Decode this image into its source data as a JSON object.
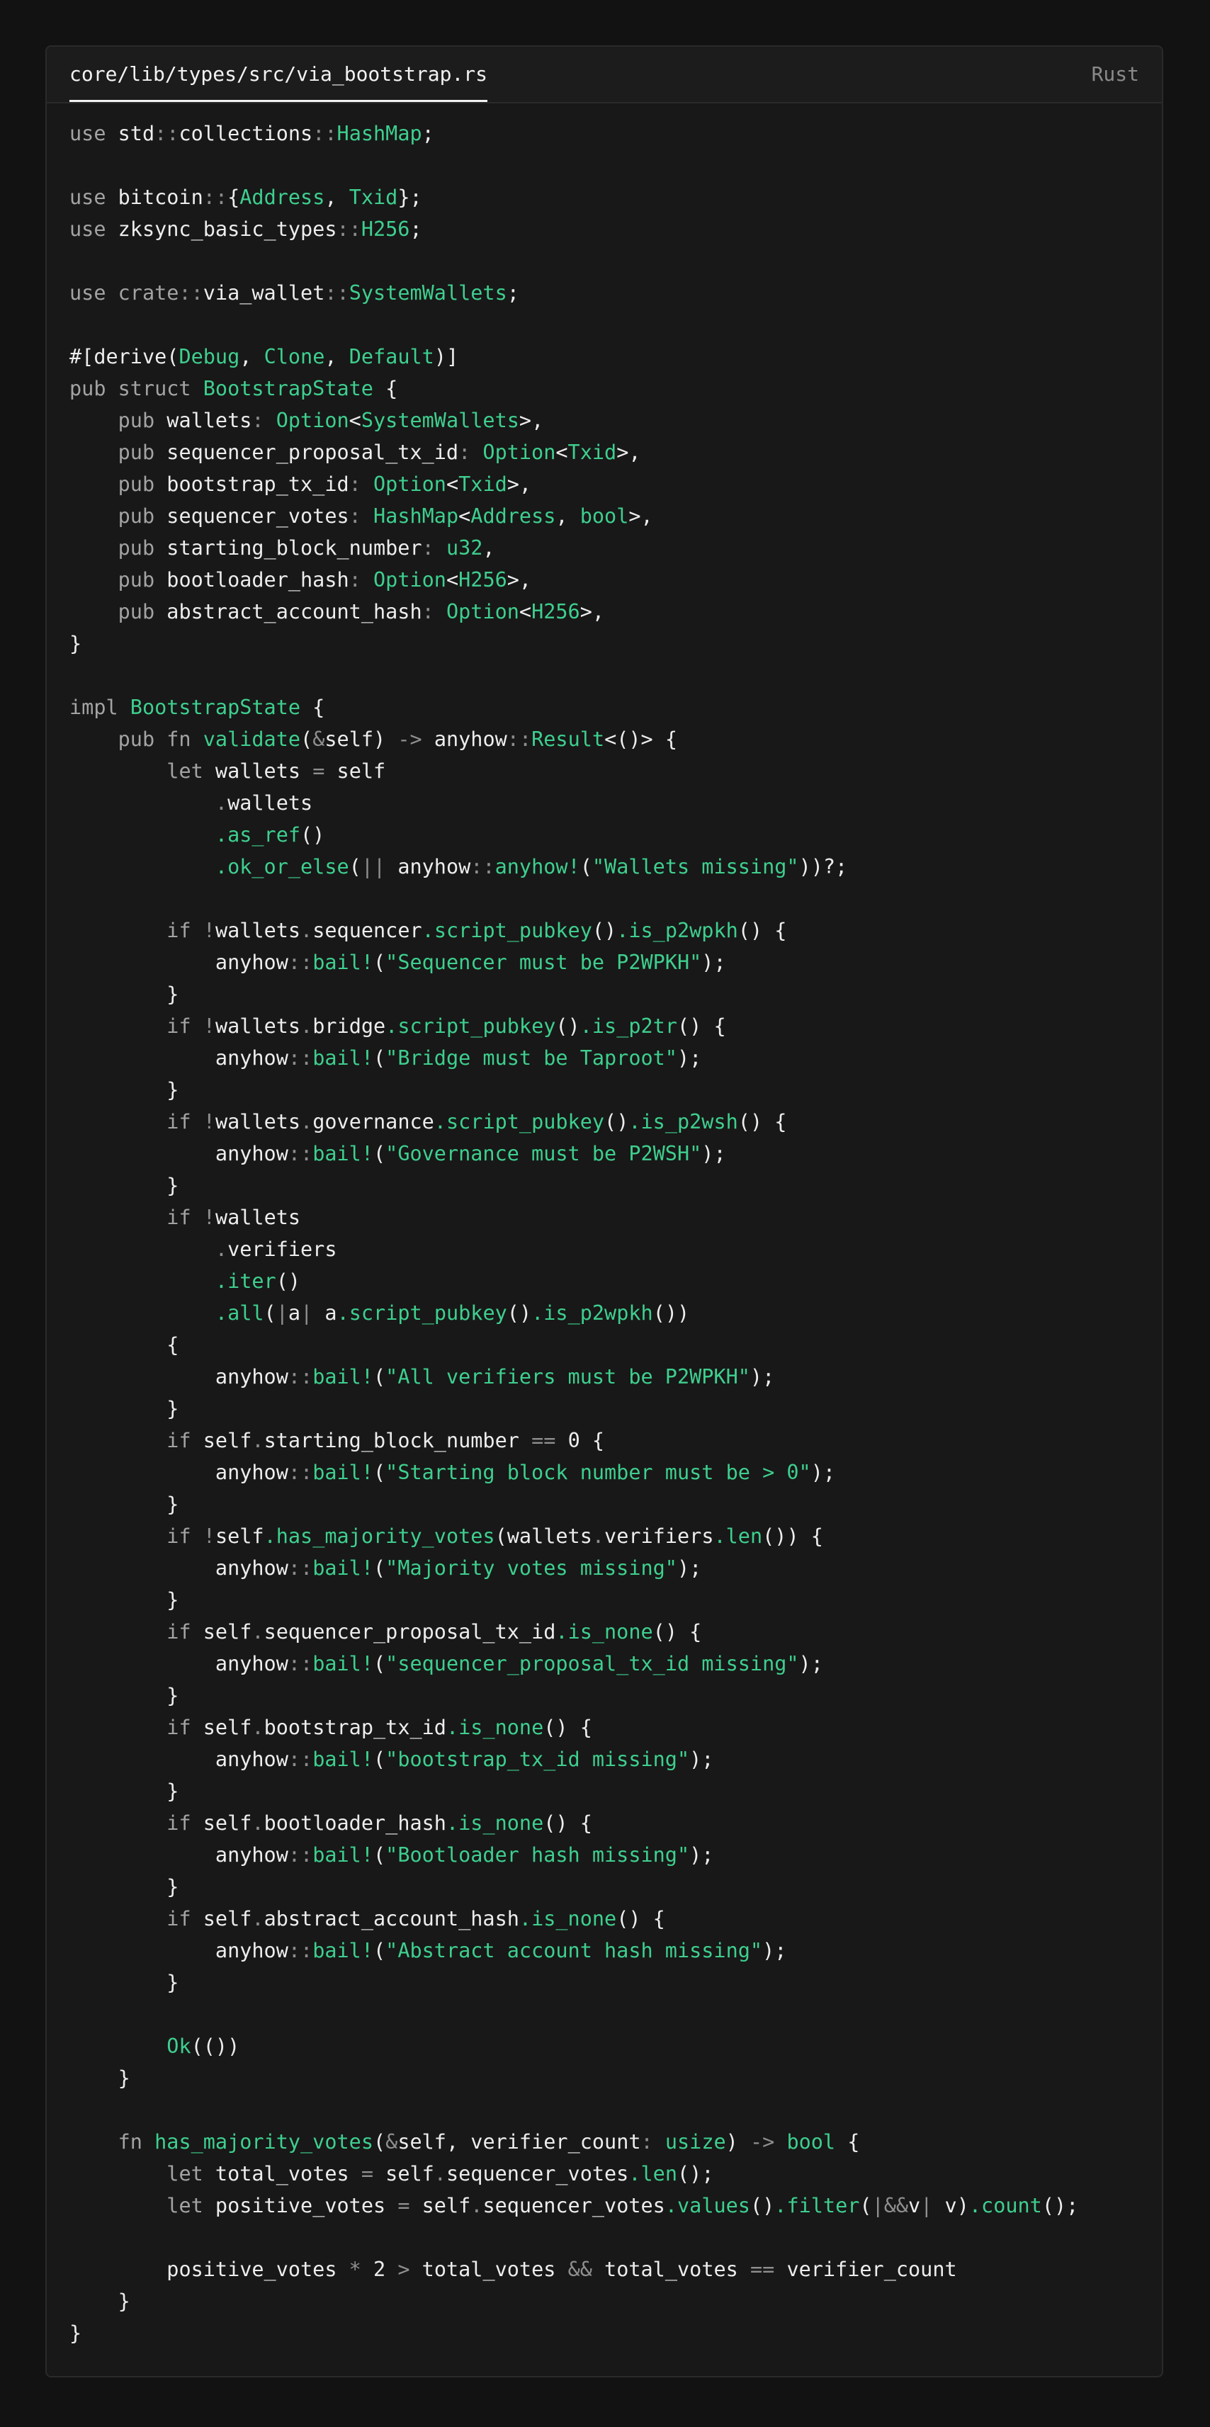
{
  "file": {
    "path": "core/lib/types/src/via_bootstrap.rs",
    "language": "Rust"
  },
  "theme": {
    "background": "#121212",
    "panel": "#181818",
    "keyword": "#a3a3a3",
    "identifier": "#ededed",
    "accent": "#3ecf8e",
    "operator": "#8f8f8f"
  },
  "code_lines": [
    [
      [
        "kw",
        "use "
      ],
      [
        "id",
        "std"
      ],
      [
        "op",
        "::"
      ],
      [
        "id",
        "collections"
      ],
      [
        "op",
        "::"
      ],
      [
        "ty",
        "HashMap"
      ],
      [
        "p",
        ";"
      ]
    ],
    [],
    [
      [
        "kw",
        "use "
      ],
      [
        "id",
        "bitcoin"
      ],
      [
        "op",
        "::"
      ],
      [
        "p",
        "{"
      ],
      [
        "ty",
        "Address"
      ],
      [
        "p",
        ", "
      ],
      [
        "ty",
        "Txid"
      ],
      [
        "p",
        "};"
      ]
    ],
    [
      [
        "kw",
        "use "
      ],
      [
        "id",
        "zksync_basic_types"
      ],
      [
        "op",
        "::"
      ],
      [
        "ty",
        "H256"
      ],
      [
        "p",
        ";"
      ]
    ],
    [],
    [
      [
        "kw",
        "use "
      ],
      [
        "kw",
        "crate"
      ],
      [
        "op",
        "::"
      ],
      [
        "id",
        "via_wallet"
      ],
      [
        "op",
        "::"
      ],
      [
        "ty",
        "SystemWallets"
      ],
      [
        "p",
        ";"
      ]
    ],
    [],
    [
      [
        "p",
        "#["
      ],
      [
        "id",
        "derive"
      ],
      [
        "p",
        "("
      ],
      [
        "ty",
        "Debug"
      ],
      [
        "p",
        ", "
      ],
      [
        "ty",
        "Clone"
      ],
      [
        "p",
        ", "
      ],
      [
        "ty",
        "Default"
      ],
      [
        "p",
        ")]"
      ]
    ],
    [
      [
        "kw",
        "pub struct "
      ],
      [
        "ty",
        "BootstrapState"
      ],
      [
        "p",
        " {"
      ]
    ],
    [
      [
        "p",
        "    "
      ],
      [
        "kw",
        "pub "
      ],
      [
        "id",
        "wallets"
      ],
      [
        "op",
        ": "
      ],
      [
        "ty",
        "Option"
      ],
      [
        "p",
        "<"
      ],
      [
        "ty",
        "SystemWallets"
      ],
      [
        "p",
        ">,"
      ]
    ],
    [
      [
        "p",
        "    "
      ],
      [
        "kw",
        "pub "
      ],
      [
        "id",
        "sequencer_proposal_tx_id"
      ],
      [
        "op",
        ": "
      ],
      [
        "ty",
        "Option"
      ],
      [
        "p",
        "<"
      ],
      [
        "ty",
        "Txid"
      ],
      [
        "p",
        ">,"
      ]
    ],
    [
      [
        "p",
        "    "
      ],
      [
        "kw",
        "pub "
      ],
      [
        "id",
        "bootstrap_tx_id"
      ],
      [
        "op",
        ": "
      ],
      [
        "ty",
        "Option"
      ],
      [
        "p",
        "<"
      ],
      [
        "ty",
        "Txid"
      ],
      [
        "p",
        ">,"
      ]
    ],
    [
      [
        "p",
        "    "
      ],
      [
        "kw",
        "pub "
      ],
      [
        "id",
        "sequencer_votes"
      ],
      [
        "op",
        ": "
      ],
      [
        "ty",
        "HashMap"
      ],
      [
        "p",
        "<"
      ],
      [
        "ty",
        "Address"
      ],
      [
        "p",
        ", "
      ],
      [
        "ty",
        "bool"
      ],
      [
        "p",
        ">,"
      ]
    ],
    [
      [
        "p",
        "    "
      ],
      [
        "kw",
        "pub "
      ],
      [
        "id",
        "starting_block_number"
      ],
      [
        "op",
        ": "
      ],
      [
        "ty",
        "u32"
      ],
      [
        "p",
        ","
      ]
    ],
    [
      [
        "p",
        "    "
      ],
      [
        "kw",
        "pub "
      ],
      [
        "id",
        "bootloader_hash"
      ],
      [
        "op",
        ": "
      ],
      [
        "ty",
        "Option"
      ],
      [
        "p",
        "<"
      ],
      [
        "ty",
        "H256"
      ],
      [
        "p",
        ">,"
      ]
    ],
    [
      [
        "p",
        "    "
      ],
      [
        "kw",
        "pub "
      ],
      [
        "id",
        "abstract_account_hash"
      ],
      [
        "op",
        ": "
      ],
      [
        "ty",
        "Option"
      ],
      [
        "p",
        "<"
      ],
      [
        "ty",
        "H256"
      ],
      [
        "p",
        ">,"
      ]
    ],
    [
      [
        "p",
        "}"
      ]
    ],
    [],
    [
      [
        "kw",
        "impl "
      ],
      [
        "ty",
        "BootstrapState"
      ],
      [
        "p",
        " {"
      ]
    ],
    [
      [
        "p",
        "    "
      ],
      [
        "kw",
        "pub fn "
      ],
      [
        "fn",
        "validate"
      ],
      [
        "p",
        "("
      ],
      [
        "op",
        "&"
      ],
      [
        "id",
        "self"
      ],
      [
        "p",
        ") "
      ],
      [
        "op",
        "-> "
      ],
      [
        "id",
        "anyhow"
      ],
      [
        "op",
        "::"
      ],
      [
        "ty",
        "Result"
      ],
      [
        "p",
        "<()> {"
      ]
    ],
    [
      [
        "p",
        "        "
      ],
      [
        "kw",
        "let "
      ],
      [
        "id",
        "wallets "
      ],
      [
        "op",
        "= "
      ],
      [
        "id",
        "self"
      ]
    ],
    [
      [
        "p",
        "            "
      ],
      [
        "op",
        "."
      ],
      [
        "id",
        "wallets"
      ]
    ],
    [
      [
        "p",
        "            "
      ],
      [
        "fn",
        ".as_ref"
      ],
      [
        "p",
        "()"
      ]
    ],
    [
      [
        "p",
        "            "
      ],
      [
        "fn",
        ".ok_or_else"
      ],
      [
        "p",
        "("
      ],
      [
        "op",
        "|| "
      ],
      [
        "id",
        "anyhow"
      ],
      [
        "op",
        "::"
      ],
      [
        "fn",
        "anyhow!"
      ],
      [
        "p",
        "("
      ],
      [
        "st",
        "\"Wallets missing\""
      ],
      [
        "p",
        "))?;"
      ]
    ],
    [],
    [
      [
        "p",
        "        "
      ],
      [
        "kw",
        "if "
      ],
      [
        "op",
        "!"
      ],
      [
        "id",
        "wallets"
      ],
      [
        "op",
        "."
      ],
      [
        "id",
        "sequencer"
      ],
      [
        "fn",
        ".script_pubkey"
      ],
      [
        "p",
        "()"
      ],
      [
        "fn",
        ".is_p2wpkh"
      ],
      [
        "p",
        "() {"
      ]
    ],
    [
      [
        "p",
        "            "
      ],
      [
        "id",
        "anyhow"
      ],
      [
        "op",
        "::"
      ],
      [
        "fn",
        "bail!"
      ],
      [
        "p",
        "("
      ],
      [
        "st",
        "\"Sequencer must be P2WPKH\""
      ],
      [
        "p",
        ");"
      ]
    ],
    [
      [
        "p",
        "        }"
      ]
    ],
    [
      [
        "p",
        "        "
      ],
      [
        "kw",
        "if "
      ],
      [
        "op",
        "!"
      ],
      [
        "id",
        "wallets"
      ],
      [
        "op",
        "."
      ],
      [
        "id",
        "bridge"
      ],
      [
        "fn",
        ".script_pubkey"
      ],
      [
        "p",
        "()"
      ],
      [
        "fn",
        ".is_p2tr"
      ],
      [
        "p",
        "() {"
      ]
    ],
    [
      [
        "p",
        "            "
      ],
      [
        "id",
        "anyhow"
      ],
      [
        "op",
        "::"
      ],
      [
        "fn",
        "bail!"
      ],
      [
        "p",
        "("
      ],
      [
        "st",
        "\"Bridge must be Taproot\""
      ],
      [
        "p",
        ");"
      ]
    ],
    [
      [
        "p",
        "        }"
      ]
    ],
    [
      [
        "p",
        "        "
      ],
      [
        "kw",
        "if "
      ],
      [
        "op",
        "!"
      ],
      [
        "id",
        "wallets"
      ],
      [
        "op",
        "."
      ],
      [
        "id",
        "governance"
      ],
      [
        "fn",
        ".script_pubkey"
      ],
      [
        "p",
        "()"
      ],
      [
        "fn",
        ".is_p2wsh"
      ],
      [
        "p",
        "() {"
      ]
    ],
    [
      [
        "p",
        "            "
      ],
      [
        "id",
        "anyhow"
      ],
      [
        "op",
        "::"
      ],
      [
        "fn",
        "bail!"
      ],
      [
        "p",
        "("
      ],
      [
        "st",
        "\"Governance must be P2WSH\""
      ],
      [
        "p",
        ");"
      ]
    ],
    [
      [
        "p",
        "        }"
      ]
    ],
    [
      [
        "p",
        "        "
      ],
      [
        "kw",
        "if "
      ],
      [
        "op",
        "!"
      ],
      [
        "id",
        "wallets"
      ]
    ],
    [
      [
        "p",
        "            "
      ],
      [
        "op",
        "."
      ],
      [
        "id",
        "verifiers"
      ]
    ],
    [
      [
        "p",
        "            "
      ],
      [
        "fn",
        ".iter"
      ],
      [
        "p",
        "()"
      ]
    ],
    [
      [
        "p",
        "            "
      ],
      [
        "fn",
        ".all"
      ],
      [
        "p",
        "("
      ],
      [
        "op",
        "|"
      ],
      [
        "id",
        "a"
      ],
      [
        "op",
        "| "
      ],
      [
        "id",
        "a"
      ],
      [
        "fn",
        ".script_pubkey"
      ],
      [
        "p",
        "()"
      ],
      [
        "fn",
        ".is_p2wpkh"
      ],
      [
        "p",
        "())"
      ]
    ],
    [
      [
        "p",
        "        {"
      ]
    ],
    [
      [
        "p",
        "            "
      ],
      [
        "id",
        "anyhow"
      ],
      [
        "op",
        "::"
      ],
      [
        "fn",
        "bail!"
      ],
      [
        "p",
        "("
      ],
      [
        "st",
        "\"All verifiers must be P2WPKH\""
      ],
      [
        "p",
        ");"
      ]
    ],
    [
      [
        "p",
        "        }"
      ]
    ],
    [
      [
        "p",
        "        "
      ],
      [
        "kw",
        "if "
      ],
      [
        "id",
        "self"
      ],
      [
        "op",
        "."
      ],
      [
        "id",
        "starting_block_number "
      ],
      [
        "op",
        "== "
      ],
      [
        "id",
        "0"
      ],
      [
        "p",
        " {"
      ]
    ],
    [
      [
        "p",
        "            "
      ],
      [
        "id",
        "anyhow"
      ],
      [
        "op",
        "::"
      ],
      [
        "fn",
        "bail!"
      ],
      [
        "p",
        "("
      ],
      [
        "st",
        "\"Starting block number must be > 0\""
      ],
      [
        "p",
        ");"
      ]
    ],
    [
      [
        "p",
        "        }"
      ]
    ],
    [
      [
        "p",
        "        "
      ],
      [
        "kw",
        "if "
      ],
      [
        "op",
        "!"
      ],
      [
        "id",
        "self"
      ],
      [
        "fn",
        ".has_majority_votes"
      ],
      [
        "p",
        "("
      ],
      [
        "id",
        "wallets"
      ],
      [
        "op",
        "."
      ],
      [
        "id",
        "verifiers"
      ],
      [
        "fn",
        ".len"
      ],
      [
        "p",
        "()) {"
      ]
    ],
    [
      [
        "p",
        "            "
      ],
      [
        "id",
        "anyhow"
      ],
      [
        "op",
        "::"
      ],
      [
        "fn",
        "bail!"
      ],
      [
        "p",
        "("
      ],
      [
        "st",
        "\"Majority votes missing\""
      ],
      [
        "p",
        ");"
      ]
    ],
    [
      [
        "p",
        "        }"
      ]
    ],
    [
      [
        "p",
        "        "
      ],
      [
        "kw",
        "if "
      ],
      [
        "id",
        "self"
      ],
      [
        "op",
        "."
      ],
      [
        "id",
        "sequencer_proposal_tx_id"
      ],
      [
        "fn",
        ".is_none"
      ],
      [
        "p",
        "() {"
      ]
    ],
    [
      [
        "p",
        "            "
      ],
      [
        "id",
        "anyhow"
      ],
      [
        "op",
        "::"
      ],
      [
        "fn",
        "bail!"
      ],
      [
        "p",
        "("
      ],
      [
        "st",
        "\"sequencer_proposal_tx_id missing\""
      ],
      [
        "p",
        ");"
      ]
    ],
    [
      [
        "p",
        "        }"
      ]
    ],
    [
      [
        "p",
        "        "
      ],
      [
        "kw",
        "if "
      ],
      [
        "id",
        "self"
      ],
      [
        "op",
        "."
      ],
      [
        "id",
        "bootstrap_tx_id"
      ],
      [
        "fn",
        ".is_none"
      ],
      [
        "p",
        "() {"
      ]
    ],
    [
      [
        "p",
        "            "
      ],
      [
        "id",
        "anyhow"
      ],
      [
        "op",
        "::"
      ],
      [
        "fn",
        "bail!"
      ],
      [
        "p",
        "("
      ],
      [
        "st",
        "\"bootstrap_tx_id missing\""
      ],
      [
        "p",
        ");"
      ]
    ],
    [
      [
        "p",
        "        }"
      ]
    ],
    [
      [
        "p",
        "        "
      ],
      [
        "kw",
        "if "
      ],
      [
        "id",
        "self"
      ],
      [
        "op",
        "."
      ],
      [
        "id",
        "bootloader_hash"
      ],
      [
        "fn",
        ".is_none"
      ],
      [
        "p",
        "() {"
      ]
    ],
    [
      [
        "p",
        "            "
      ],
      [
        "id",
        "anyhow"
      ],
      [
        "op",
        "::"
      ],
      [
        "fn",
        "bail!"
      ],
      [
        "p",
        "("
      ],
      [
        "st",
        "\"Bootloader hash missing\""
      ],
      [
        "p",
        ");"
      ]
    ],
    [
      [
        "p",
        "        }"
      ]
    ],
    [
      [
        "p",
        "        "
      ],
      [
        "kw",
        "if "
      ],
      [
        "id",
        "self"
      ],
      [
        "op",
        "."
      ],
      [
        "id",
        "abstract_account_hash"
      ],
      [
        "fn",
        ".is_none"
      ],
      [
        "p",
        "() {"
      ]
    ],
    [
      [
        "p",
        "            "
      ],
      [
        "id",
        "anyhow"
      ],
      [
        "op",
        "::"
      ],
      [
        "fn",
        "bail!"
      ],
      [
        "p",
        "("
      ],
      [
        "st",
        "\"Abstract account hash missing\""
      ],
      [
        "p",
        ");"
      ]
    ],
    [
      [
        "p",
        "        }"
      ]
    ],
    [],
    [
      [
        "p",
        "        "
      ],
      [
        "fn",
        "Ok"
      ],
      [
        "p",
        "(())"
      ]
    ],
    [
      [
        "p",
        "    }"
      ]
    ],
    [],
    [
      [
        "p",
        "    "
      ],
      [
        "kw",
        "fn "
      ],
      [
        "fn",
        "has_majority_votes"
      ],
      [
        "p",
        "("
      ],
      [
        "op",
        "&"
      ],
      [
        "id",
        "self"
      ],
      [
        "p",
        ", "
      ],
      [
        "id",
        "verifier_count"
      ],
      [
        "op",
        ": "
      ],
      [
        "ty",
        "usize"
      ],
      [
        "p",
        ") "
      ],
      [
        "op",
        "-> "
      ],
      [
        "ty",
        "bool"
      ],
      [
        "p",
        " {"
      ]
    ],
    [
      [
        "p",
        "        "
      ],
      [
        "kw",
        "let "
      ],
      [
        "id",
        "total_votes "
      ],
      [
        "op",
        "= "
      ],
      [
        "id",
        "self"
      ],
      [
        "op",
        "."
      ],
      [
        "id",
        "sequencer_votes"
      ],
      [
        "fn",
        ".len"
      ],
      [
        "p",
        "();"
      ]
    ],
    [
      [
        "p",
        "        "
      ],
      [
        "kw",
        "let "
      ],
      [
        "id",
        "positive_votes "
      ],
      [
        "op",
        "= "
      ],
      [
        "id",
        "self"
      ],
      [
        "op",
        "."
      ],
      [
        "id",
        "sequencer_votes"
      ],
      [
        "fn",
        ".values"
      ],
      [
        "p",
        "()"
      ],
      [
        "fn",
        ".filter"
      ],
      [
        "p",
        "("
      ],
      [
        "op",
        "|&&"
      ],
      [
        "id",
        "v"
      ],
      [
        "op",
        "| "
      ],
      [
        "id",
        "v"
      ],
      [
        "p",
        ")"
      ],
      [
        "fn",
        ".count"
      ],
      [
        "p",
        "();"
      ]
    ],
    [],
    [
      [
        "p",
        "        "
      ],
      [
        "id",
        "positive_votes "
      ],
      [
        "op",
        "* "
      ],
      [
        "id",
        "2 "
      ],
      [
        "op",
        "> "
      ],
      [
        "id",
        "total_votes "
      ],
      [
        "op",
        "&& "
      ],
      [
        "id",
        "total_votes "
      ],
      [
        "op",
        "== "
      ],
      [
        "id",
        "verifier_count"
      ]
    ],
    [
      [
        "p",
        "    }"
      ]
    ],
    [
      [
        "p",
        "}"
      ]
    ]
  ]
}
